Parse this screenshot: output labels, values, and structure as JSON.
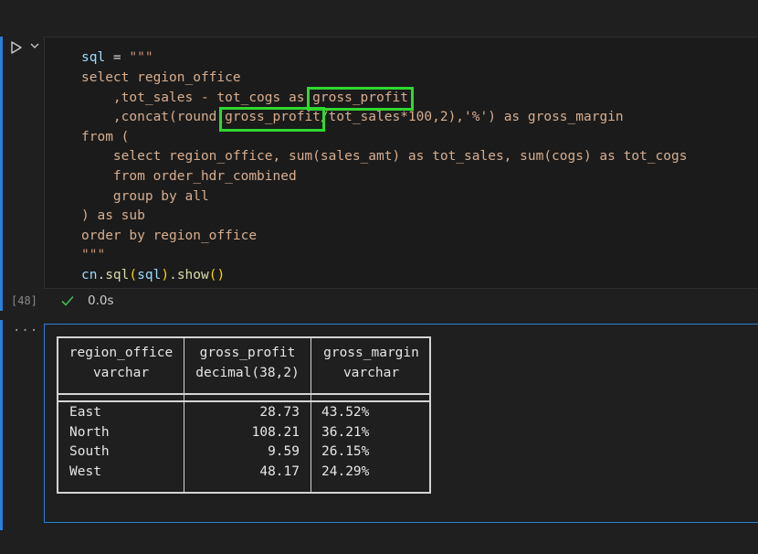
{
  "cell": {
    "execution_count": "[48]",
    "duration": "0.0s",
    "output_marker": "···",
    "code": {
      "line1": {
        "var": "sql",
        "eq": " = ",
        "str": "\"\"\""
      },
      "line2": "select region_office",
      "line3_a": ",tot_sales - tot_cogs as ",
      "line3_b": "gross_profit",
      "line4_a": ",concat(round(",
      "line4_b": "gross_profit",
      "line4_c": "/tot_sales*100,2),'%') as gross_margin",
      "line5": "from (",
      "line6": "select region_office, sum(sales_amt) as tot_sales, sum(cogs) as tot_cogs",
      "line7": "from order_hdr_combined",
      "line8": "group by all",
      "line9": ") as sub",
      "line10": "order by region_office",
      "line11": "\"\"\"",
      "line12": {
        "obj": "cn",
        "dot1": ".",
        "fn1": "sql",
        "p1": "(",
        "arg": "sql",
        "p2": ")",
        "dot2": ".",
        "fn2": "show",
        "p3": "()"
      }
    }
  },
  "result_table": {
    "columns": [
      {
        "name": "region_office",
        "type": "varchar"
      },
      {
        "name": "gross_profit",
        "type": "decimal(38,2)"
      },
      {
        "name": "gross_margin",
        "type": "varchar"
      }
    ],
    "rows": [
      {
        "region_office": "East",
        "gross_profit": "28.73",
        "gross_margin": "43.52%"
      },
      {
        "region_office": "North",
        "gross_profit": "108.21",
        "gross_margin": "36.21%"
      },
      {
        "region_office": "South",
        "gross_profit": "9.59",
        "gross_margin": "26.15%"
      },
      {
        "region_office": "West",
        "gross_profit": "48.17",
        "gross_margin": "24.29%"
      }
    ]
  },
  "colors": {
    "accent": "#2b7fd8",
    "highlight": "#2fd82f",
    "success": "#3fb950"
  },
  "icons": {
    "run": "play-triangle",
    "more": "chevron-down",
    "status": "check-mark"
  }
}
